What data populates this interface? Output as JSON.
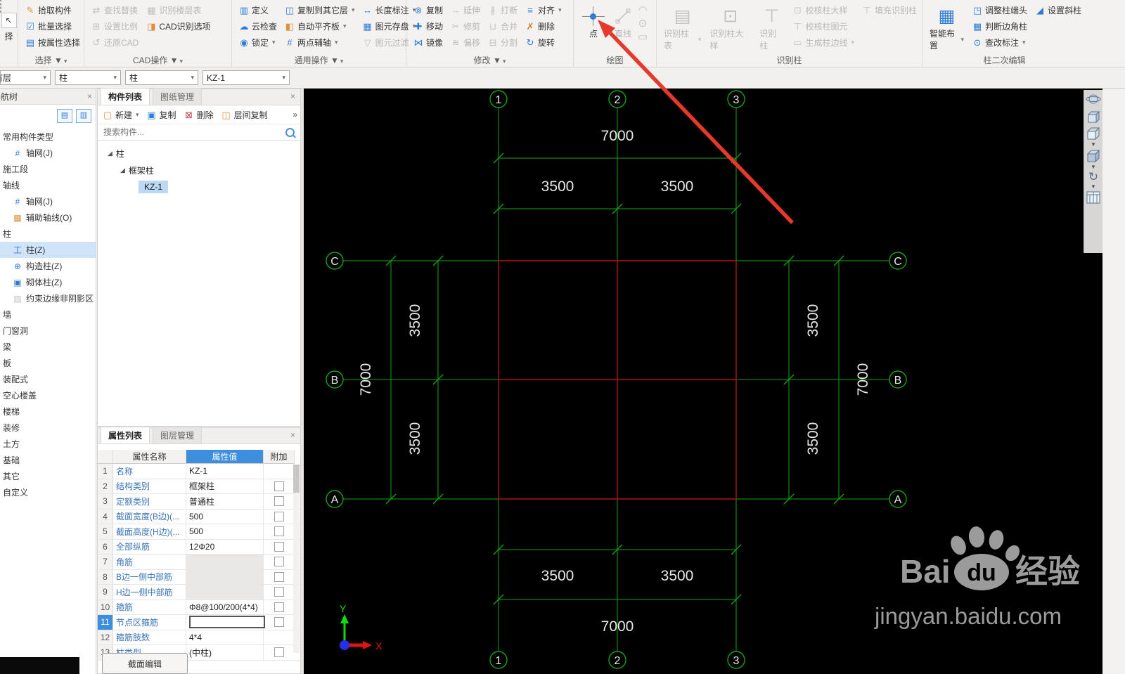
{
  "app": {
    "edge_button": "择"
  },
  "icons": {
    "close": "×",
    "more": "»",
    "expander": "◢"
  },
  "ribbon": {
    "groups": {
      "select": {
        "label": "选择 ▼",
        "items": [
          "拾取构件",
          "批量选择",
          "按属性选择"
        ]
      },
      "cad": {
        "label": "CAD操作 ▼",
        "col1": [
          "查找替换",
          "设置比例",
          "还原CAD"
        ],
        "col2": [
          "识别楼层表",
          "CAD识别选项"
        ]
      },
      "common": {
        "label": "通用操作 ▼",
        "col1": [
          "定义",
          "云检查",
          "锁定"
        ],
        "col2": [
          "复制到其它层",
          "自动平齐板",
          "两点辅轴"
        ],
        "col3": [
          "长度标注",
          "图元存盘",
          "图元过滤"
        ]
      },
      "modify": {
        "label": "修改 ▼",
        "col1": [
          "复制",
          "移动",
          "镜像"
        ],
        "col2": [
          "延伸",
          "修剪",
          "偏移"
        ],
        "col3": [
          "打断",
          "合并",
          "分割"
        ],
        "col4": [
          "对齐",
          "删除",
          "旋转"
        ]
      },
      "draw": {
        "label": "绘图",
        "point": "点",
        "line": "直线"
      },
      "recognize": {
        "label": "识别柱",
        "big": [
          "识别柱表",
          "识别柱大样",
          "识别柱"
        ],
        "col": [
          "校核柱大样",
          "校核柱图元",
          "生成柱边线"
        ],
        "fill": "填充识别柱"
      },
      "column_edit": {
        "label": "柱二次编辑",
        "big": "智能布置",
        "col": [
          "调整柱端头",
          "判断边角柱",
          "查改标注"
        ],
        "slant": "设置斜柱"
      }
    }
  },
  "toolbar": {
    "floor": "首层",
    "category": "柱",
    "type": "柱",
    "component": "KZ-1"
  },
  "sidebar": {
    "title": "导航树",
    "items": [
      {
        "label": "常用构件类型",
        "kind": "header"
      },
      {
        "label": "轴网(J)",
        "kind": "item"
      },
      {
        "label": "施工段",
        "kind": "header"
      },
      {
        "label": "轴线",
        "kind": "header"
      },
      {
        "label": "轴网(J)",
        "kind": "item"
      },
      {
        "label": "辅助轴线(O)",
        "kind": "item"
      },
      {
        "label": "柱",
        "kind": "header"
      },
      {
        "label": "柱(Z)",
        "kind": "item",
        "selected": true
      },
      {
        "label": "构造柱(Z)",
        "kind": "item"
      },
      {
        "label": "砌体柱(Z)",
        "kind": "item"
      },
      {
        "label": "约束边缘非阴影区",
        "kind": "item"
      },
      {
        "label": "墙",
        "kind": "header"
      },
      {
        "label": "门窗洞",
        "kind": "header"
      },
      {
        "label": "梁",
        "kind": "header"
      },
      {
        "label": "板",
        "kind": "header"
      },
      {
        "label": "装配式",
        "kind": "header"
      },
      {
        "label": "空心楼盖",
        "kind": "header"
      },
      {
        "label": "楼梯",
        "kind": "header"
      },
      {
        "label": "装修",
        "kind": "header"
      },
      {
        "label": "土方",
        "kind": "header"
      },
      {
        "label": "基础",
        "kind": "header"
      },
      {
        "label": "其它",
        "kind": "header"
      },
      {
        "label": "自定义",
        "kind": "header"
      }
    ]
  },
  "component_panel": {
    "tab_list": "构件列表",
    "tab_drawing": "图纸管理",
    "btn_new": "新建",
    "btn_copy": "复制",
    "btn_delete": "删除",
    "btn_interfloor": "层间复制",
    "search_placeholder": "搜索构件...",
    "tree_root": "柱",
    "tree_group": "框架柱",
    "tree_item": "KZ-1"
  },
  "props": {
    "tab_props": "属性列表",
    "tab_layers": "图层管理",
    "col_name": "属性名称",
    "col_value": "属性值",
    "col_extra": "附加",
    "rows": [
      {
        "n": "1",
        "name": "名称",
        "value": "KZ-1"
      },
      {
        "n": "2",
        "name": "结构类别",
        "value": "框架柱"
      },
      {
        "n": "3",
        "name": "定额类别",
        "value": "普通柱"
      },
      {
        "n": "4",
        "name": "截面宽度(B边)(...",
        "value": "500"
      },
      {
        "n": "5",
        "name": "截面高度(H边)(...",
        "value": "500"
      },
      {
        "n": "6",
        "name": "全部纵筋",
        "value": "12Φ20"
      },
      {
        "n": "7",
        "name": "角筋",
        "value": ""
      },
      {
        "n": "8",
        "name": "B边一侧中部筋",
        "value": ""
      },
      {
        "n": "9",
        "name": "H边一侧中部筋",
        "value": ""
      },
      {
        "n": "10",
        "name": "箍筋",
        "value": "Φ8@100/200(4*4)"
      },
      {
        "n": "11",
        "name": "节点区箍筋",
        "value": ""
      },
      {
        "n": "12",
        "name": "箍筋肢数",
        "value": "4*4"
      },
      {
        "n": "13",
        "name": "柱类型",
        "value": "(中柱)"
      }
    ],
    "section_edit": "截面编辑"
  },
  "drawing": {
    "top": [
      "1",
      "2",
      "3"
    ],
    "bottom": [
      "1",
      "2",
      "3"
    ],
    "left": [
      "C",
      "B",
      "A"
    ],
    "right": [
      "C",
      "B",
      "A"
    ],
    "dim_top": [
      "7000",
      "3500",
      "3500"
    ],
    "dim_bottom": [
      "3500",
      "3500",
      "7000"
    ],
    "dim_left": [
      "3500",
      "7000",
      "3500"
    ],
    "dim_right": [
      "3500",
      "7000",
      "3500"
    ],
    "ucs_x": "X",
    "ucs_y": "Y"
  },
  "watermark": {
    "bai": "Bai",
    "du": "du",
    "jingyan": "经验",
    "url": "jingyan.baidu.com"
  },
  "colors": {
    "axis_green": "#12a312",
    "cad_red": "#b01414",
    "arrow_red": "#e6382b",
    "accent_blue": "#2e7cd6",
    "value_header_blue": "#3e8ede"
  }
}
